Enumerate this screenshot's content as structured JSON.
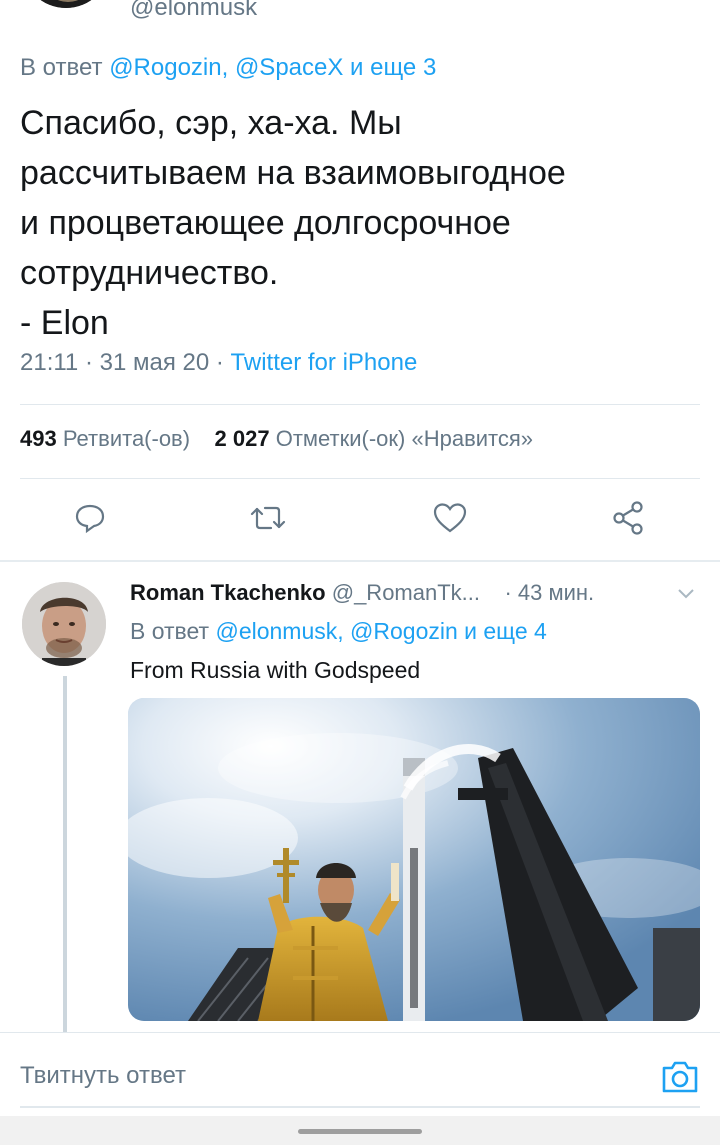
{
  "header": {
    "handle": "@elonmusk"
  },
  "tweet": {
    "reply_prefix": "В ответ ",
    "reply_targets": "@Rogozin, @SpaceX и еще 3",
    "text_lines": [
      "Спасибо, сэр, ха-ха. Мы",
      "рассчитываем на взаимовыгодное",
      "и процветающее долгосрочное",
      "сотрудничество.",
      "- Elon"
    ],
    "time": "21:11",
    "date": "31 мая 20",
    "source": "Twitter for iPhone",
    "retweets_count": "493",
    "retweets_label": "Ретвита(-ов)",
    "likes_count": "2 027",
    "likes_label": "Отметки(-ок) «Нравится»"
  },
  "actions": {
    "reply_icon": "reply-icon",
    "retweet_icon": "retweet-icon",
    "like_icon": "heart-icon",
    "share_icon": "share-icon"
  },
  "reply": {
    "name": "Roman Tkachenko",
    "handle": "@_RomanTk...",
    "time": "· 43 мин.",
    "reply_prefix": "В ответ ",
    "reply_targets": "@elonmusk, @Rogozin и еще 4",
    "text": "From Russia with Godspeed"
  },
  "composer": {
    "placeholder": "Твитнуть ответ",
    "camera_icon": "camera-icon"
  },
  "colors": {
    "accent": "#1da1f2",
    "secondary_text": "#657786",
    "primary_text": "#14171a",
    "divider": "#e1e8ed"
  }
}
